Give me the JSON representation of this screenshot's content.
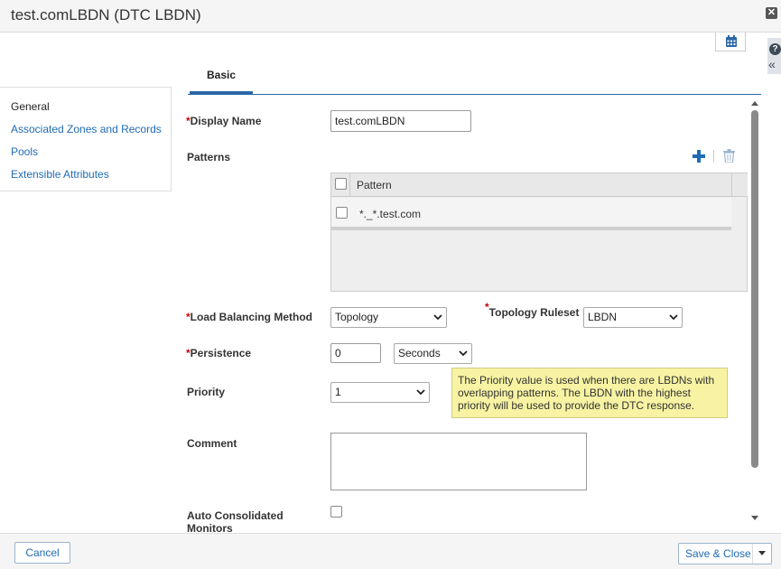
{
  "window": {
    "title": "test.comLBDN (DTC LBDN)"
  },
  "colors": {
    "accent": "#2a67a7",
    "link": "#1f6bb5",
    "required": "#cc0000",
    "tooltip_bg": "#f7f3a3"
  },
  "sidebar": {
    "items": [
      {
        "label": "General",
        "active": true
      },
      {
        "label": "Associated Zones and Records",
        "active": false
      },
      {
        "label": "Pools",
        "active": false
      },
      {
        "label": "Extensible Attributes",
        "active": false
      }
    ]
  },
  "tabs": [
    {
      "label": "Basic",
      "active": true
    }
  ],
  "form": {
    "required_mark": "*",
    "display_name": {
      "label": "Display Name",
      "value": "test.comLBDN"
    },
    "patterns": {
      "label": "Patterns",
      "column_header": "Pattern",
      "rows": [
        {
          "value": "*._*.test.com",
          "checked": false
        }
      ]
    },
    "load_balancing": {
      "label": "Load Balancing Method",
      "value": "Topology"
    },
    "topology_ruleset": {
      "label": "Topology Ruleset",
      "value": "LBDN"
    },
    "persistence": {
      "label": "Persistence",
      "value": "0",
      "unit": "Seconds"
    },
    "priority": {
      "label": "Priority",
      "value": "1"
    },
    "priority_tooltip": "The Priority value is used when there are LBDNs with overlapping patterns. The LBDN with the highest priority will be used to provide the DTC response.",
    "comment": {
      "label": "Comment",
      "value": ""
    },
    "auto_consolidated": {
      "label": "Auto Consolidated Monitors",
      "checked": false
    }
  },
  "icons": {
    "close": "close-icon",
    "help": "help-icon",
    "collapse": "double-chevron-left-icon",
    "calendar": "calendar-icon",
    "add": "plus-icon",
    "delete": "trash-icon"
  },
  "footer": {
    "cancel_label": "Cancel",
    "save_label": "Save & Close"
  }
}
